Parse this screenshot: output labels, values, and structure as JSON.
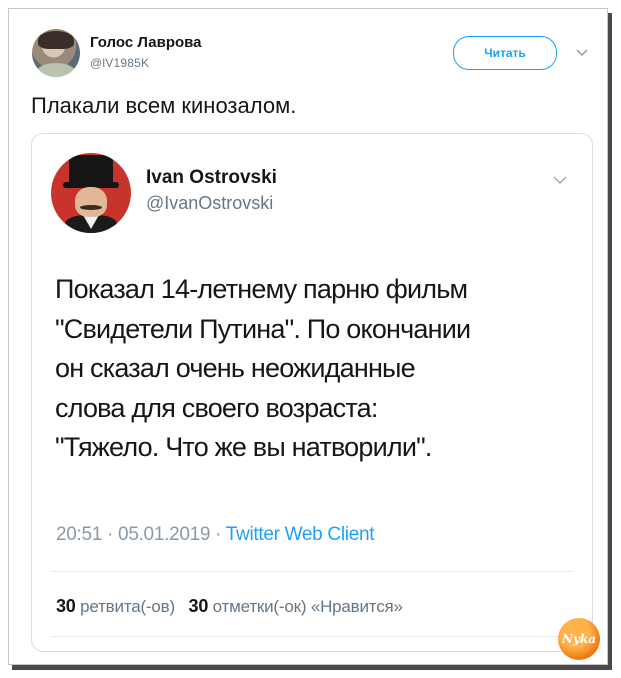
{
  "tweet": {
    "author_name": "Голос Лаврова",
    "author_handle": "@lV1985K",
    "follow_label": "Читать",
    "text": "Плакали всем кинозалом."
  },
  "quoted": {
    "author_name": "Ivan Ostrovski",
    "author_handle": "@IvanOstrovski",
    "lines": [
      "Показал 14-летнему парню фильм",
      "\"Свидетели Путина\". По окончании",
      "он сказал очень неожиданные",
      "слова для своего возраста:",
      "\"Тяжело. Что же вы натворили\"."
    ],
    "time": "20:51",
    "date": "05.01.2019",
    "client": "Twitter Web Client",
    "retweets_count": "30",
    "retweets_label": "ретвита(-ов)",
    "likes_count": "30",
    "likes_label": "отметки(-ок) «Нравится»"
  },
  "watermark": "Nyka",
  "icons": [
    "chevron-down-icon"
  ],
  "colors": {
    "accent": "#1da1f2",
    "text": "#14171a",
    "muted": "#657786"
  }
}
